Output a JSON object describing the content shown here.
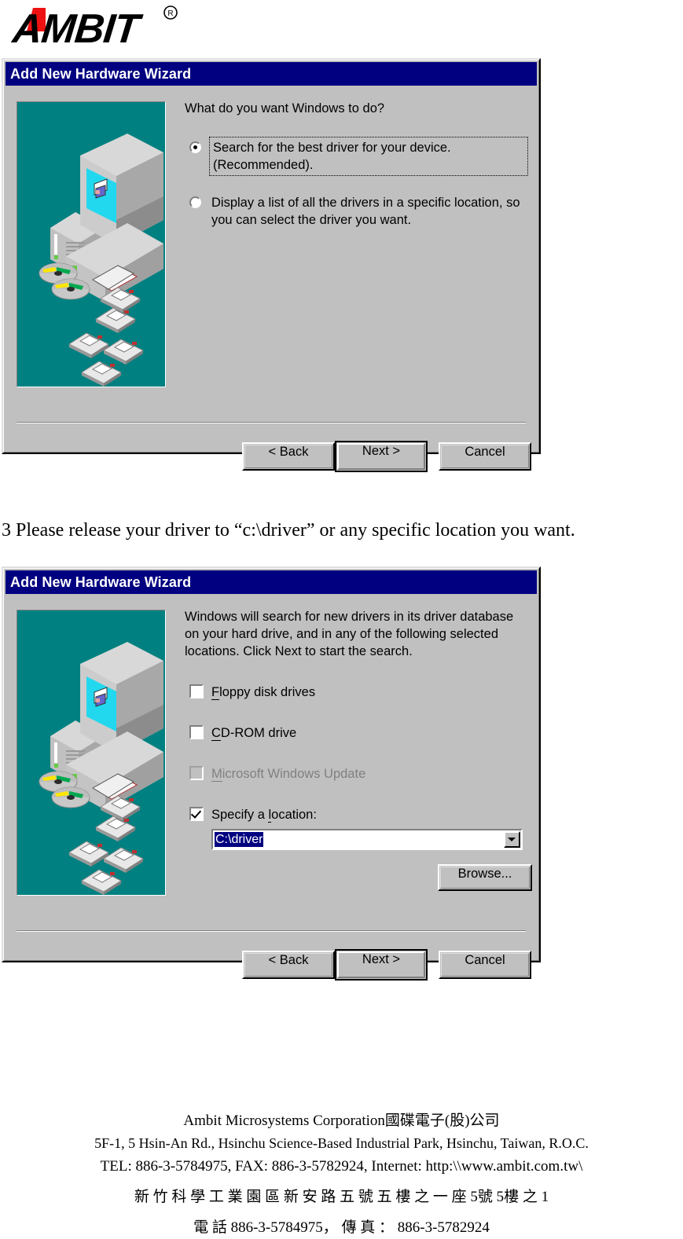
{
  "logo": {
    "brand": "AMBIT",
    "registered_mark": "®"
  },
  "dialog1": {
    "title": "Add New Hardware Wizard",
    "prompt": "What do you want Windows to do?",
    "options": [
      {
        "id": "search-best-driver",
        "label": "Search for the best driver for your device.\n(Recommended).",
        "selected": true,
        "focused": true
      },
      {
        "id": "display-list-drivers",
        "label": "Display a list of all the drivers in a specific\nlocation, so you can select the driver you want.",
        "selected": false,
        "focused": false
      }
    ],
    "buttons": {
      "back": "< Back",
      "next": "Next >",
      "cancel": "Cancel"
    }
  },
  "step_note": {
    "text": "3 Please release your driver to “c:\\driver” or any specific location you want."
  },
  "dialog2": {
    "title": "Add New Hardware Wizard",
    "prompt": "Windows will search for new drivers in its driver database\non your hard drive, and in any of the following selected\nlocations. Click Next to start the search.",
    "checkboxes": [
      {
        "id": "floppy-disk-drives",
        "label": "Floppy disk drives",
        "checked": false,
        "disabled": false
      },
      {
        "id": "cd-rom-drive",
        "label": "CD-ROM drive",
        "checked": false,
        "disabled": false
      },
      {
        "id": "microsoft-windows-update",
        "label": "Microsoft Windows Update",
        "checked": false,
        "disabled": true
      },
      {
        "id": "specify-a-location",
        "label": "Specify a location:",
        "checked": true,
        "disabled": false
      }
    ],
    "location_combo": {
      "value": "C:\\driver",
      "selected": true
    },
    "browse_button": "Browse...",
    "buttons": {
      "back": "< Back",
      "next": "Next >",
      "cancel": "Cancel"
    }
  },
  "footer": {
    "company_en": "Ambit Microsystems Corporation",
    "company_cjk": "國碟電子(股)公司",
    "address_en": "5F-1, 5 Hsin-An Rd., Hsinchu Science-Based Industrial Park, Hsinchu, Taiwan, R.O.C.",
    "contact_en": "TEL: 886-3-5784975, FAX: 886-3-5782924, Internet: http:\\\\www.ambit.com.tw\\",
    "address_cjk": "新竹科學工業園區新安路五號五樓之一",
    "address_cjk_display": "新 竹 科 學 工 業 園 區 新 安 路 五 號 五 樓 之 一 座 5號 5樓 之 1",
    "phone_cjk_display": "電 話 886-3-5784975， 傳 真 ： 886-3-5782924",
    "phone_label_cjk": "電話",
    "fax_label_cjk": "傳真",
    "phone_number": "886-3-5784975",
    "fax_number": "886-3-5782924"
  },
  "colors": {
    "titlebar": "#000080",
    "dialog_face": "#c0c0c0",
    "wizard_art_bg": "#008080",
    "logo_accent": "#ee1111",
    "selection": "#000080"
  }
}
